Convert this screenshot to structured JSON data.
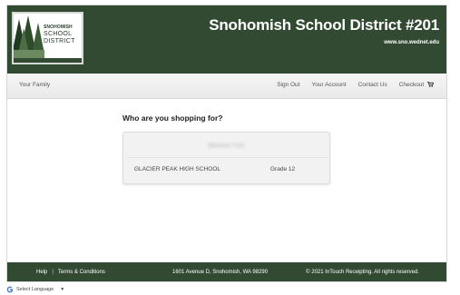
{
  "header": {
    "logo": {
      "line1": "SNOHOMISH",
      "line2": "SCHOOL",
      "line3": "DISTRICT"
    },
    "title": "Snohomish School District #201",
    "url": "www.sno.wednet.edu"
  },
  "nav": {
    "left": "Your Family",
    "items": [
      "Sign Out",
      "Your Account",
      "Contact Us",
      "Checkout"
    ]
  },
  "main": {
    "question": "Who are you shopping for?",
    "student": {
      "name": "Mxxxxxx Txxx",
      "school": "GLACIER PEAK HIGH SCHOOL",
      "grade": "Grade 12"
    }
  },
  "footer": {
    "help": "Help",
    "separator": "|",
    "terms": "Terms & Conditions",
    "address": "1601 Avenue D, Snohomish, WA 98290",
    "copyright": "© 2021 InTouch Receipting. All rights reserved."
  },
  "language": {
    "label": "Select Language",
    "arrow": "▼"
  },
  "colors": {
    "brand_green": "#334a32",
    "nav_bg": "#efefef",
    "card_bg": "#f2f2f2"
  },
  "icons": {
    "cart": "shopping-cart-icon",
    "google": "google-g-icon",
    "trees": "evergreen-trees-icon"
  }
}
